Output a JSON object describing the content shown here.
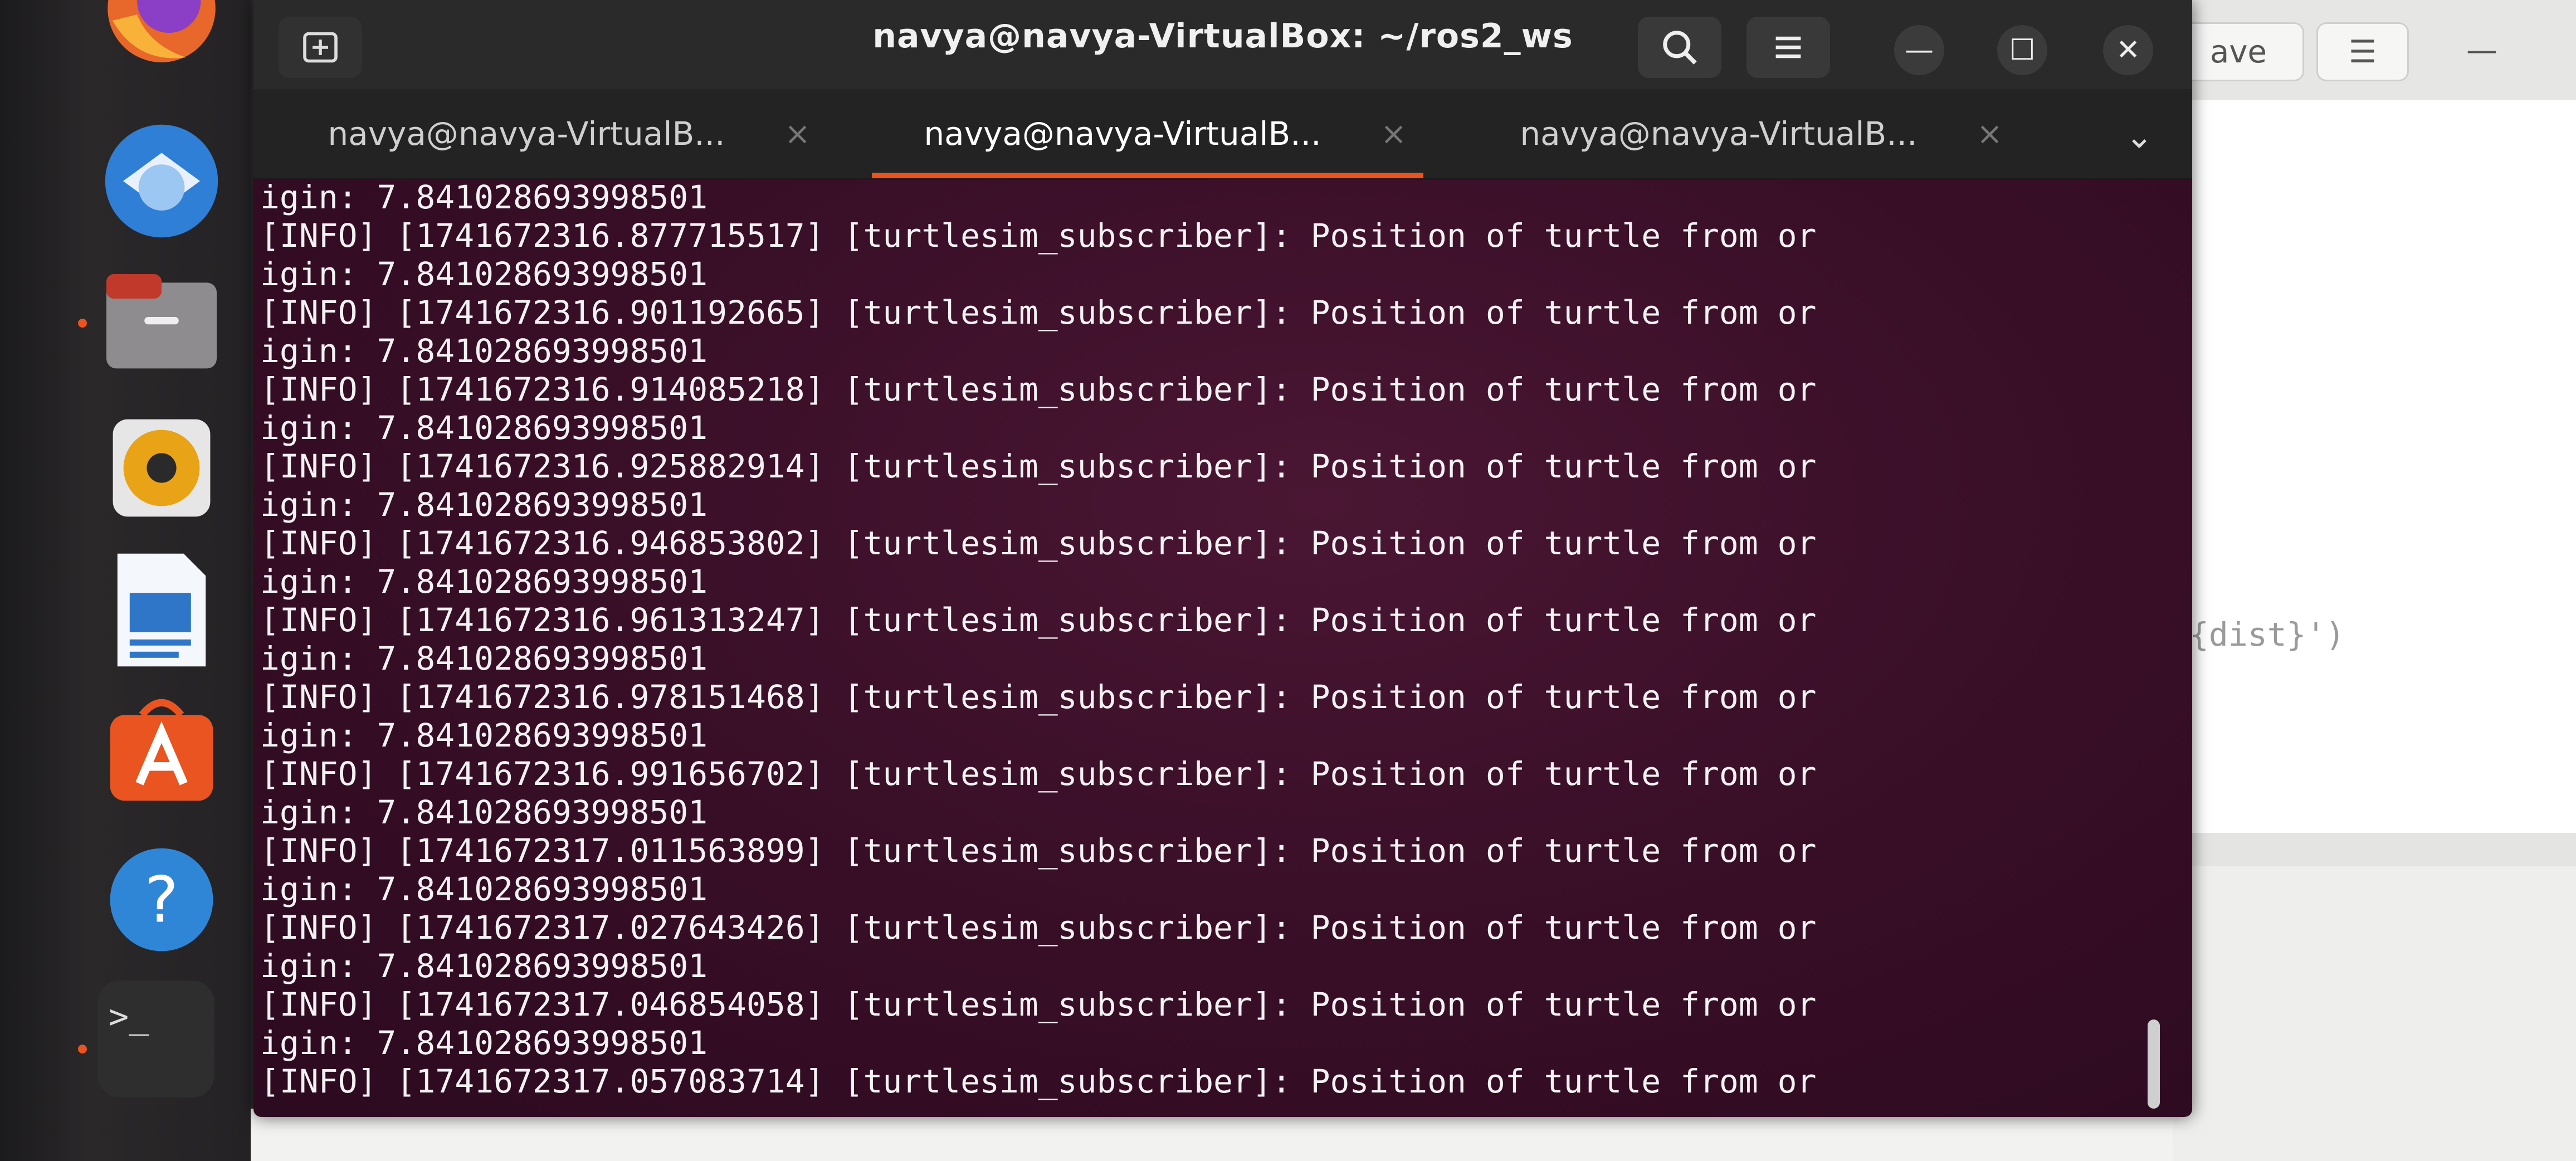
{
  "terminal": {
    "title": "navya@navya-VirtualBox: ~/ros2_ws",
    "new_tab_icon": "new-tab-icon",
    "search_icon": "search-icon",
    "menu_icon": "hamburger-menu-icon",
    "minimize_glyph": "—",
    "maximize_glyph": "☐",
    "close_glyph": "✕",
    "tabs": [
      {
        "label": "navya@navya-VirtualB...",
        "active": false
      },
      {
        "label": "navya@navya-VirtualB...",
        "active": true
      },
      {
        "label": "navya@navya-VirtualB...",
        "active": false
      }
    ],
    "tab_close_glyph": "×",
    "tab_menu_glyph": "⌄",
    "accent_color": "#e95420",
    "background_color": "#3a0f28",
    "lines": [
      "igin: 7.841028693998501",
      "[INFO] [1741672316.877715517] [turtlesim_subscriber]: Position of turtle from or",
      "igin: 7.841028693998501",
      "[INFO] [1741672316.901192665] [turtlesim_subscriber]: Position of turtle from or",
      "igin: 7.841028693998501",
      "[INFO] [1741672316.914085218] [turtlesim_subscriber]: Position of turtle from or",
      "igin: 7.841028693998501",
      "[INFO] [1741672316.925882914] [turtlesim_subscriber]: Position of turtle from or",
      "igin: 7.841028693998501",
      "[INFO] [1741672316.946853802] [turtlesim_subscriber]: Position of turtle from or",
      "igin: 7.841028693998501",
      "[INFO] [1741672316.961313247] [turtlesim_subscriber]: Position of turtle from or",
      "igin: 7.841028693998501",
      "[INFO] [1741672316.978151468] [turtlesim_subscriber]: Position of turtle from or",
      "igin: 7.841028693998501",
      "[INFO] [1741672316.991656702] [turtlesim_subscriber]: Position of turtle from or",
      "igin: 7.841028693998501",
      "[INFO] [1741672317.011563899] [turtlesim_subscriber]: Position of turtle from or",
      "igin: 7.841028693998501",
      "[INFO] [1741672317.027643426] [turtlesim_subscriber]: Position of turtle from or",
      "igin: 7.841028693998501",
      "[INFO] [1741672317.046854058] [turtlesim_subscriber]: Position of turtle from or",
      "igin: 7.841028693998501",
      "[INFO] [1741672317.057083714] [turtlesim_subscriber]: Position of turtle from or"
    ]
  },
  "background_editor": {
    "save_label": "ave",
    "menu_glyph": "☰",
    "minimize_glyph": "—",
    "code_fragment": "{dist}')"
  },
  "dock": {
    "apps": [
      {
        "name": "firefox-icon",
        "color": "#e8672a"
      },
      {
        "name": "thunderbird-icon",
        "color": "#2f7fd6"
      },
      {
        "name": "files-icon",
        "color": "#8a8a8a"
      },
      {
        "name": "rhythmbox-icon",
        "color": "#e8a317"
      },
      {
        "name": "writer-icon",
        "color": "#2f76c8"
      },
      {
        "name": "app-center-icon",
        "color": "#e95420"
      },
      {
        "name": "help-icon",
        "color": "#2f86d6"
      },
      {
        "name": "terminal-icon",
        "color": "#2e2e2e"
      }
    ],
    "help_glyph": "?",
    "terminal_glyph": ">_"
  }
}
